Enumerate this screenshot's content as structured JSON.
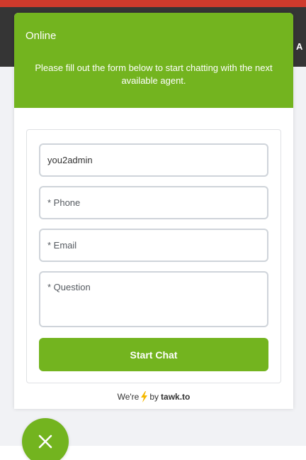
{
  "background": {
    "nav_text": "A"
  },
  "widget": {
    "status": "Online",
    "greeting": "Please fill out the form below to start chatting with the next available agent.",
    "form": {
      "name_value": "you2admin",
      "phone_placeholder": "* Phone",
      "email_placeholder": "* Email",
      "question_placeholder": "* Question",
      "submit_label": "Start Chat"
    },
    "branding": {
      "prefix": "We're",
      "middle": "by",
      "brand": "tawk.to"
    }
  },
  "colors": {
    "accent": "#73b41f",
    "top_bar": "#cf3a2c",
    "nav_bar": "#353535"
  },
  "icons": {
    "bolt": "lightning-bolt-icon",
    "close": "close-icon"
  }
}
